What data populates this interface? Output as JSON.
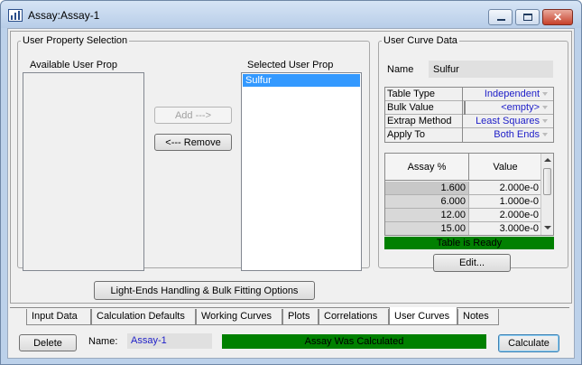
{
  "window": {
    "title": "Assay:Assay-1"
  },
  "user_property_selection": {
    "legend": "User Property Selection",
    "available_label": "Available User Prop",
    "selected_label": "Selected User Prop",
    "available_items": [],
    "selected_items": [
      "Sulfur"
    ],
    "add_button": "Add --->",
    "remove_button": "<--- Remove"
  },
  "user_curve_data": {
    "legend": "User Curve Data",
    "name_label": "Name",
    "name_value": "Sulfur",
    "properties": [
      {
        "key": "Table Type",
        "value": "Independent"
      },
      {
        "key": "Bulk Value",
        "value": "<empty>"
      },
      {
        "key": "Extrap Method",
        "value": "Least Squares"
      },
      {
        "key": "Apply To",
        "value": "Both Ends"
      }
    ],
    "table": {
      "headers": [
        "Assay %",
        "Value"
      ],
      "rows": [
        [
          "1.600",
          "2.000e-0"
        ],
        [
          "6.000",
          "1.000e-0"
        ],
        [
          "12.00",
          "2.000e-0"
        ],
        [
          "15.00",
          "3.000e-0"
        ]
      ]
    },
    "table_status": "Table is Ready",
    "edit_button": "Edit..."
  },
  "light_ends_button": "Light-Ends Handling & Bulk Fitting Options",
  "tabs": [
    {
      "label": "Input Data",
      "active": false
    },
    {
      "label": "Calculation Defaults",
      "active": false
    },
    {
      "label": "Working Curves",
      "active": false
    },
    {
      "label": "Plots",
      "active": false
    },
    {
      "label": "Correlations",
      "active": false
    },
    {
      "label": "User Curves",
      "active": true
    },
    {
      "label": "Notes",
      "active": false
    }
  ],
  "bottom": {
    "delete_button": "Delete",
    "name_label": "Name:",
    "name_value": "Assay-1",
    "status": "Assay Was Calculated",
    "calculate_button": "Calculate"
  },
  "colors": {
    "status_green": "#008000",
    "selection_blue": "#3399ff",
    "value_blue": "#2020c8"
  }
}
